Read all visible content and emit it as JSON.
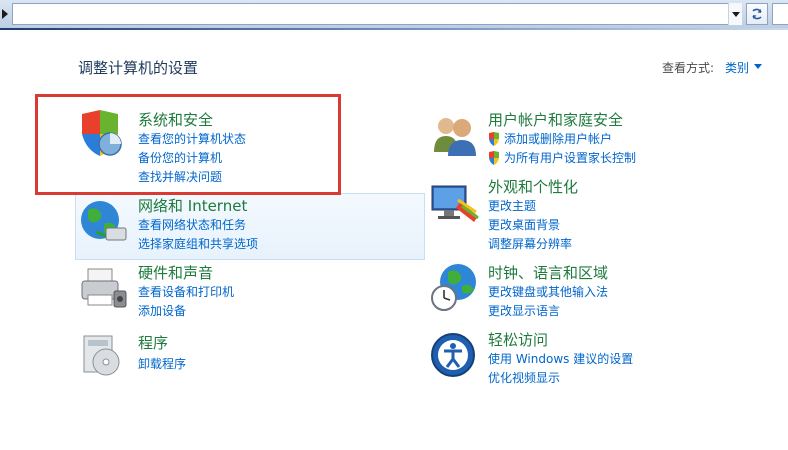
{
  "view": {
    "title": "调整计算机的设置",
    "view_by_label": "查看方式:",
    "view_by_value": "类别"
  },
  "categories": {
    "system_security": {
      "title": "系统和安全",
      "links": [
        "查看您的计算机状态",
        "备份您的计算机",
        "查找并解决问题"
      ]
    },
    "network": {
      "title": "网络和 Internet",
      "links": [
        "查看网络状态和任务",
        "选择家庭组和共享选项"
      ]
    },
    "hardware": {
      "title": "硬件和声音",
      "links": [
        "查看设备和打印机",
        "添加设备"
      ]
    },
    "programs": {
      "title": "程序",
      "links": [
        "卸载程序"
      ]
    },
    "user_accounts": {
      "title": "用户帐户和家庭安全",
      "links": [
        "添加或删除用户帐户",
        "为所有用户设置家长控制"
      ]
    },
    "appearance": {
      "title": "外观和个性化",
      "links": [
        "更改主题",
        "更改桌面背景",
        "调整屏幕分辨率"
      ]
    },
    "clock": {
      "title": "时钟、语言和区域",
      "links": [
        "更改键盘或其他输入法",
        "更改显示语言"
      ]
    },
    "ease": {
      "title": "轻松访问",
      "links": [
        "使用 Windows 建议的设置",
        "优化视频显示"
      ]
    }
  },
  "colors": {
    "title_green": "#1e7a3d",
    "link_blue": "#0066cc",
    "highlight_red": "#d93a32"
  }
}
